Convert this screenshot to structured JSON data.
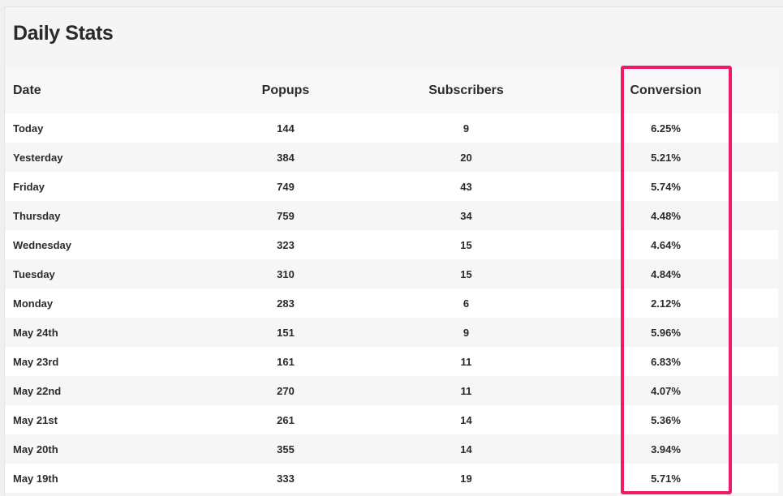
{
  "title": "Daily Stats",
  "columns": {
    "date": "Date",
    "popups": "Popups",
    "subscribers": "Subscribers",
    "conversion": "Conversion"
  },
  "rows": [
    {
      "date": "Today",
      "popups": "144",
      "subscribers": "9",
      "conversion": "6.25%"
    },
    {
      "date": "Yesterday",
      "popups": "384",
      "subscribers": "20",
      "conversion": "5.21%"
    },
    {
      "date": "Friday",
      "popups": "749",
      "subscribers": "43",
      "conversion": "5.74%"
    },
    {
      "date": "Thursday",
      "popups": "759",
      "subscribers": "34",
      "conversion": "4.48%"
    },
    {
      "date": "Wednesday",
      "popups": "323",
      "subscribers": "15",
      "conversion": "4.64%"
    },
    {
      "date": "Tuesday",
      "popups": "310",
      "subscribers": "15",
      "conversion": "4.84%"
    },
    {
      "date": "Monday",
      "popups": "283",
      "subscribers": "6",
      "conversion": "2.12%"
    },
    {
      "date": "May 24th",
      "popups": "151",
      "subscribers": "9",
      "conversion": "5.96%"
    },
    {
      "date": "May 23rd",
      "popups": "161",
      "subscribers": "11",
      "conversion": "6.83%"
    },
    {
      "date": "May 22nd",
      "popups": "270",
      "subscribers": "11",
      "conversion": "4.07%"
    },
    {
      "date": "May 21st",
      "popups": "261",
      "subscribers": "14",
      "conversion": "5.36%"
    },
    {
      "date": "May 20th",
      "popups": "355",
      "subscribers": "14",
      "conversion": "3.94%"
    },
    {
      "date": "May 19th",
      "popups": "333",
      "subscribers": "19",
      "conversion": "5.71%"
    }
  ],
  "colors": {
    "highlight": "#f0196a"
  }
}
